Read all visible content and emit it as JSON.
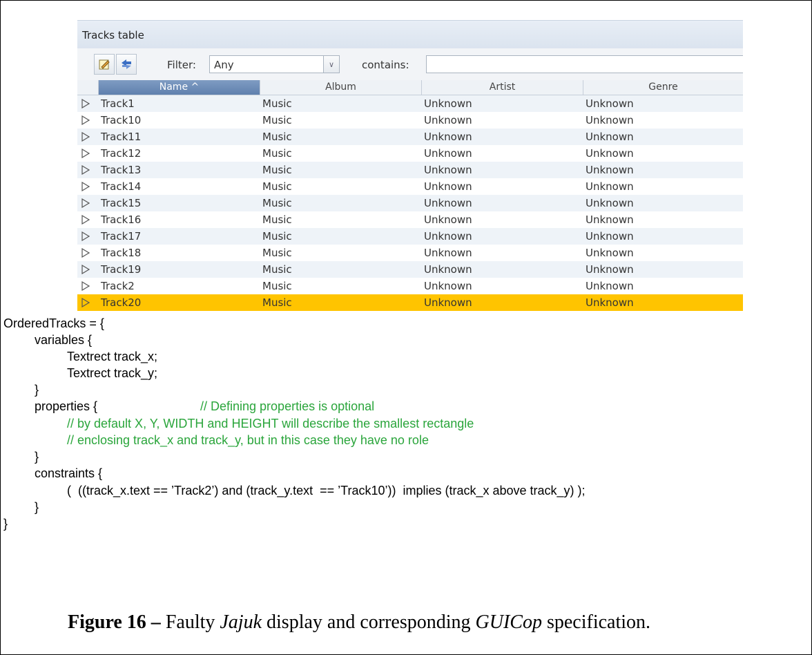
{
  "screenshot": {
    "panel_title": "Tracks table",
    "toolbar": {
      "edit_icon": "pencil-note-icon",
      "sync_icon": "sync-arrows-icon",
      "filter_label": "Filter:",
      "filter_value": "Any",
      "contains_label": "contains:",
      "contains_value": ""
    },
    "columns": [
      {
        "label": "Name ^",
        "sorted": true
      },
      {
        "label": "Album"
      },
      {
        "label": "Artist"
      },
      {
        "label": "Genre"
      }
    ],
    "rows": [
      {
        "name": "Track1",
        "album": "Music",
        "artist": "Unknown",
        "genre": "Unknown"
      },
      {
        "name": "Track10",
        "album": "Music",
        "artist": "Unknown",
        "genre": "Unknown"
      },
      {
        "name": "Track11",
        "album": "Music",
        "artist": "Unknown",
        "genre": "Unknown"
      },
      {
        "name": "Track12",
        "album": "Music",
        "artist": "Unknown",
        "genre": "Unknown"
      },
      {
        "name": "Track13",
        "album": "Music",
        "artist": "Unknown",
        "genre": "Unknown"
      },
      {
        "name": "Track14",
        "album": "Music",
        "artist": "Unknown",
        "genre": "Unknown"
      },
      {
        "name": "Track15",
        "album": "Music",
        "artist": "Unknown",
        "genre": "Unknown"
      },
      {
        "name": "Track16",
        "album": "Music",
        "artist": "Unknown",
        "genre": "Unknown"
      },
      {
        "name": "Track17",
        "album": "Music",
        "artist": "Unknown",
        "genre": "Unknown"
      },
      {
        "name": "Track18",
        "album": "Music",
        "artist": "Unknown",
        "genre": "Unknown"
      },
      {
        "name": "Track19",
        "album": "Music",
        "artist": "Unknown",
        "genre": "Unknown"
      },
      {
        "name": "Track2",
        "album": "Music",
        "artist": "Unknown",
        "genre": "Unknown"
      },
      {
        "name": "Track20",
        "album": "Music",
        "artist": "Unknown",
        "genre": "Unknown",
        "selected": true
      }
    ],
    "colors": {
      "selected_row": "#ffc400",
      "sorted_header": "#6f8fbb",
      "comment": "#2aa53b"
    }
  },
  "spec": {
    "l1": "OrderedTracks = {",
    "l2": "variables {",
    "l3": "Textrect track_x;",
    "l4": "Textrect track_y;",
    "l5": "}",
    "l6": "properties {",
    "l6_comment": "// Defining properties is optional",
    "l7": "// by default X, Y, WIDTH and HEIGHT will describe the smallest rectangle",
    "l8": "// enclosing track_x and track_y, but in this case they have no role",
    "l9": "}",
    "l10": "constraints {",
    "l11": "(  ((track_x.text == ’Track2’) and (track_y.text  == ’Track10’))  implies (track_x above track_y) );",
    "l12": "}",
    "l13": "}"
  },
  "caption": {
    "label": "Figure 16 –",
    "text_a": " Faulty ",
    "app": "Jajuk",
    "text_b": " display and corresponding ",
    "tool": "GUICop",
    "text_c": " specification."
  }
}
